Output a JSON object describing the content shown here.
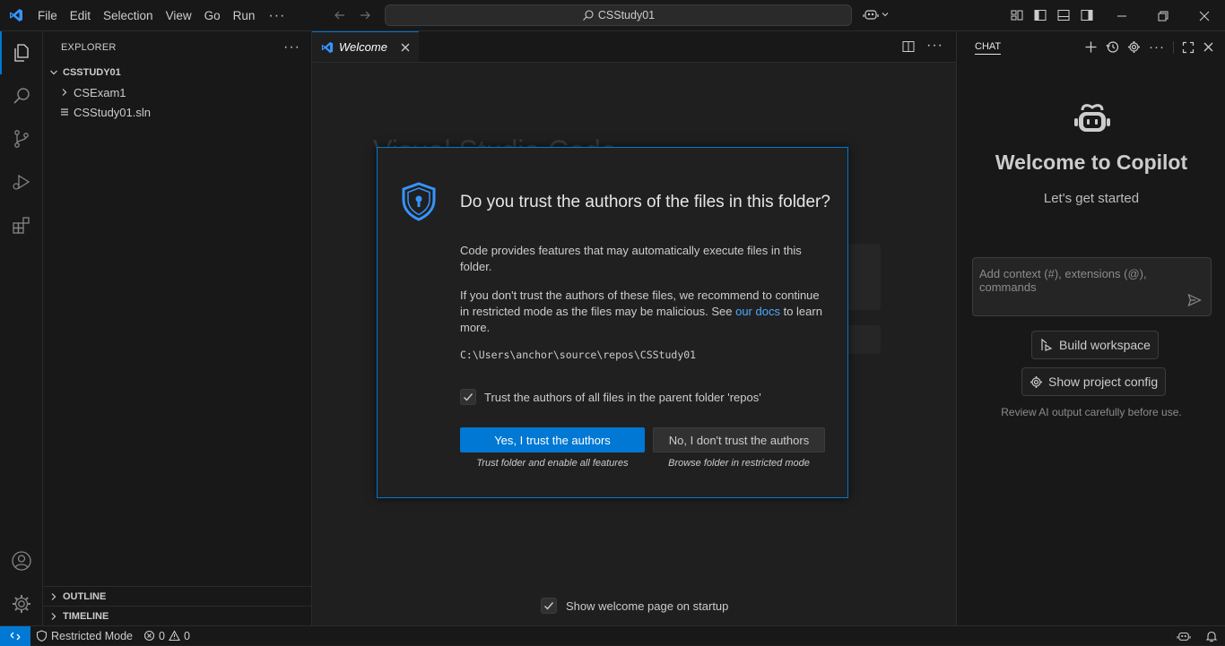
{
  "titlebar": {
    "menu": [
      "File",
      "Edit",
      "Selection",
      "View",
      "Go",
      "Run"
    ],
    "more": "···",
    "search_text": "CSStudy01"
  },
  "sidebar": {
    "header": "EXPLORER",
    "root": "CSSTUDY01",
    "items": [
      {
        "label": "CSExam1",
        "type": "folder"
      },
      {
        "label": "CSStudy01.sln",
        "type": "file"
      }
    ],
    "outline": "OUTLINE",
    "timeline": "TIMELINE"
  },
  "editor": {
    "tab_label": "Welcome",
    "background_title": "Visual Studio Code",
    "show_on_startup": "Show welcome page on startup"
  },
  "dialog": {
    "title": "Do you trust the authors of the files in this folder?",
    "para1": "Code provides features that may automatically execute files in this folder.",
    "para2_before": "If you don't trust the authors of these files, we recommend to continue in restricted mode as the files may be malicious. See ",
    "para2_link": "our docs",
    "para2_after": " to learn more.",
    "path": "C:\\Users\\anchor\\source\\repos\\CSStudy01",
    "checkbox_label": "Trust the authors of all files in the parent folder 'repos'",
    "checkbox_checked": true,
    "primary_button": "Yes, I trust the authors",
    "primary_caption": "Trust folder and enable all features",
    "secondary_button": "No, I don't trust the authors",
    "secondary_caption": "Browse folder in restricted mode"
  },
  "chat": {
    "tab": "CHAT",
    "title": "Welcome to Copilot",
    "subtitle": "Let's get started",
    "input_placeholder": "Add context (#), extensions (@), commands",
    "build_workspace": "Build workspace",
    "show_project_config": "Show project config",
    "note": "Review AI output carefully before use."
  },
  "statusbar": {
    "restricted": "Restricted Mode",
    "errors": "0",
    "warnings": "0"
  },
  "colors": {
    "accent": "#0078d4",
    "link": "#4daafc",
    "shield": "#3794ff"
  }
}
